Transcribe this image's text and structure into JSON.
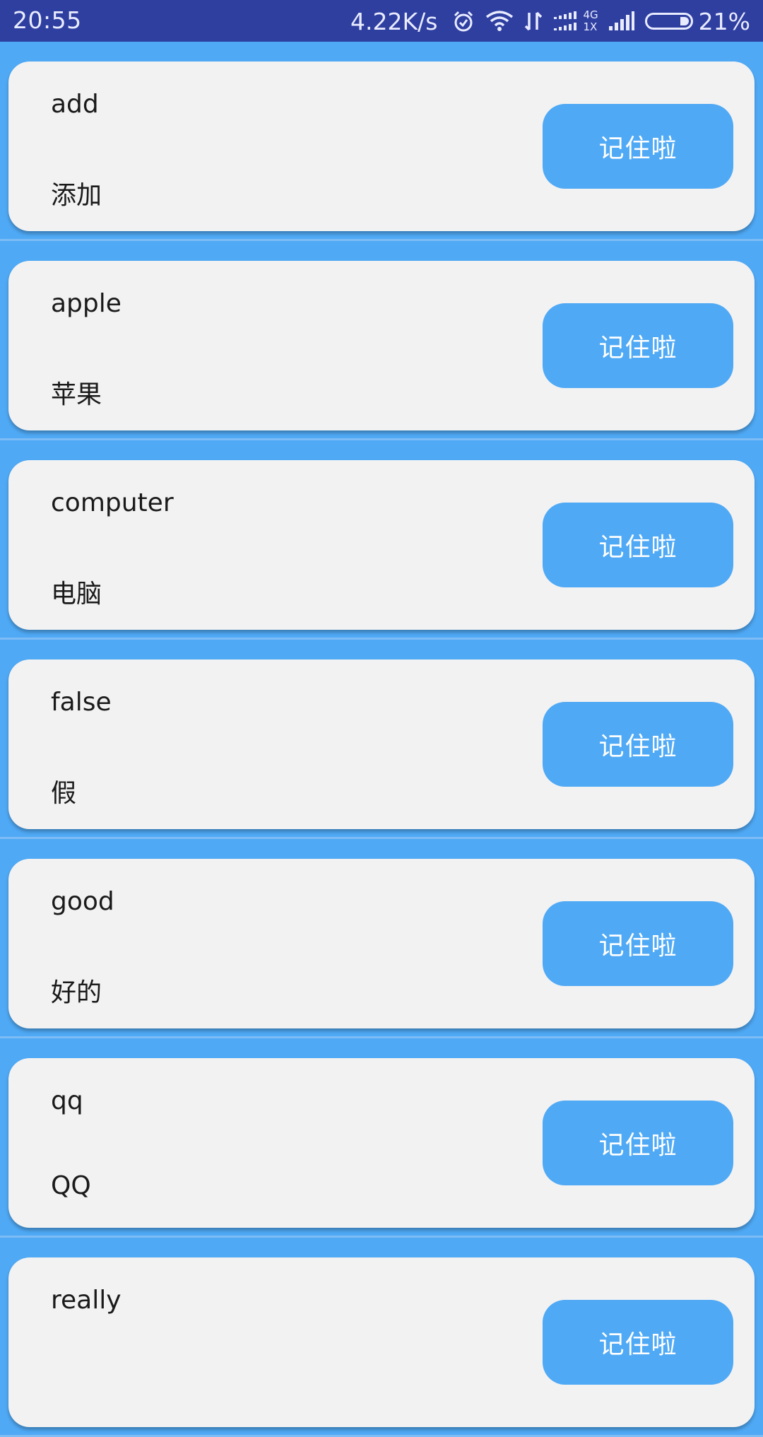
{
  "status_bar": {
    "time": "20:55",
    "net_speed": "4.22K/s",
    "net_label_top": "4G",
    "net_label_bottom": "1X",
    "battery": "21%",
    "battery_level": 0.21,
    "icons": [
      "alarm-icon",
      "wifi-icon",
      "data-transfer-icon",
      "signal-4g-icon",
      "signal-icon",
      "battery-icon"
    ]
  },
  "words": [
    {
      "word": "add",
      "meaning": "添加",
      "button": "记住啦"
    },
    {
      "word": "apple",
      "meaning": "苹果",
      "button": "记住啦"
    },
    {
      "word": "computer",
      "meaning": "电脑",
      "button": "记住啦"
    },
    {
      "word": "false",
      "meaning": "假",
      "button": "记住啦"
    },
    {
      "word": "good",
      "meaning": "好的",
      "button": "记住啦"
    },
    {
      "word": "qq",
      "meaning": "QQ",
      "button": "记住啦"
    },
    {
      "word": "really",
      "meaning": "",
      "button": "记住啦"
    }
  ],
  "colors": {
    "status_bar": "#2f3fa0",
    "background": "#4fa9f5",
    "card": "#f2f2f2",
    "button": "#4fa9f5"
  }
}
